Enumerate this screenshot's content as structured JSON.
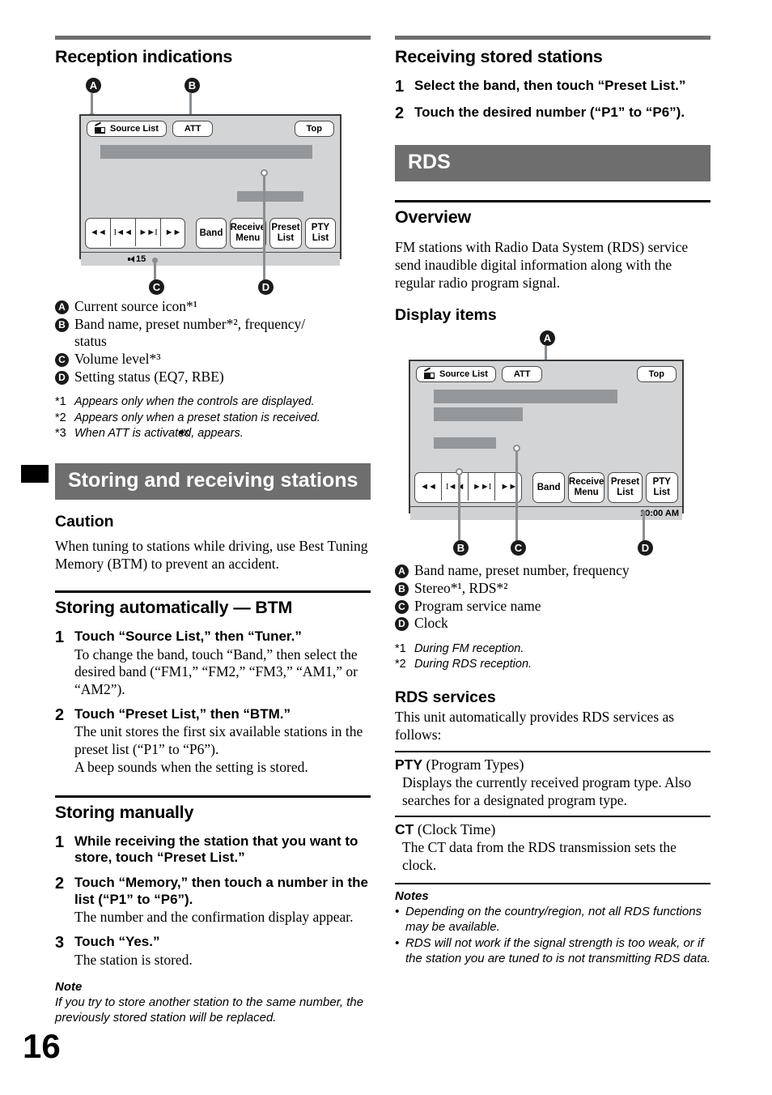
{
  "page_number": "16",
  "left_column": {
    "reception": {
      "heading": "Reception indications",
      "device": {
        "source_list_label": "Source List",
        "att_label": "ATT",
        "top_label": "Top",
        "transport": [
          "◄◄",
          "I◄◄",
          "►►I",
          "►►"
        ],
        "band_label": "Band",
        "receive_menu_label": "Receive\nMenu",
        "preset_list_label": "Preset\nList",
        "pty_list_label": "PTY\nList",
        "volume_value": "15",
        "callouts": [
          "A",
          "B",
          "C",
          "D"
        ]
      },
      "legend": [
        {
          "key": "A",
          "text": "Current source icon*¹"
        },
        {
          "key": "B",
          "text": "Band name, preset number*², frequency/"
        },
        {
          "key": "B2",
          "text": "status"
        },
        {
          "key": "C",
          "text": "Volume level*³"
        },
        {
          "key": "D",
          "text": "Setting status (EQ7, RBE)"
        }
      ],
      "footnotes": [
        {
          "mark": "*1",
          "text": "Appears only when the controls are displayed."
        },
        {
          "mark": "*2",
          "text": "Appears only when a preset station is received."
        },
        {
          "mark": "*3",
          "text": "When ATT is activated,      appears."
        }
      ]
    },
    "storing_banner": "Storing and receiving stations",
    "caution": {
      "heading": "Caution",
      "text": "When tuning to stations while driving, use Best Tuning Memory (BTM) to prevent an accident."
    },
    "btm": {
      "heading": "Storing automatically — BTM",
      "steps": [
        {
          "num": "1",
          "lead": "Touch “Source List,” then “Tuner.”",
          "desc": "To change the band, touch “Band,” then select the desired band (“FM1,” “FM2,” “FM3,” “AM1,” or “AM2”)."
        },
        {
          "num": "2",
          "lead": "Touch “Preset List,” then “BTM.”",
          "desc": "The unit stores the first six available stations in the preset list (“P1” to “P6”).\nA beep sounds when the setting is stored."
        }
      ]
    },
    "manual": {
      "heading": "Storing manually",
      "steps": [
        {
          "num": "1",
          "lead": "While receiving the station that you want to store, touch “Preset List.”",
          "desc": ""
        },
        {
          "num": "2",
          "lead": "Touch “Memory,” then touch a number in the list (“P1” to “P6”).",
          "desc": "The number and the confirmation display appear."
        },
        {
          "num": "3",
          "lead": "Touch “Yes.”",
          "desc": "The station is stored."
        }
      ]
    },
    "note": {
      "title": "Note",
      "text": "If you try to store another station to the same number, the previously stored station will be replaced."
    }
  },
  "right_column": {
    "receiving": {
      "heading": "Receiving stored stations",
      "steps": [
        {
          "num": "1",
          "lead": "Select the band, then touch “Preset List.”"
        },
        {
          "num": "2",
          "lead": "Touch the desired number (“P1” to “P6”)."
        }
      ]
    },
    "rds_banner": "RDS",
    "overview": {
      "heading": "Overview",
      "text": "FM stations with Radio Data System (RDS) service send inaudible digital information along with the regular radio program signal."
    },
    "display_items": {
      "heading": "Display items",
      "device": {
        "source_list_label": "Source List",
        "att_label": "ATT",
        "top_label": "Top",
        "transport": [
          "◄◄",
          "I◄◄",
          "►►I",
          "►►"
        ],
        "band_label": "Band",
        "receive_menu_label": "Receive\nMenu",
        "preset_list_label": "Preset\nList",
        "pty_list_label": "PTY\nList",
        "clock_value": "10:00 AM",
        "callouts": [
          "A",
          "B",
          "C",
          "D"
        ]
      },
      "legend": [
        {
          "key": "A",
          "text": "Band name, preset number, frequency"
        },
        {
          "key": "B",
          "text": "Stereo*¹, RDS*²"
        },
        {
          "key": "C",
          "text": "Program service name"
        },
        {
          "key": "D",
          "text": "Clock"
        }
      ],
      "footnotes": [
        {
          "mark": "*1",
          "text": "During FM reception."
        },
        {
          "mark": "*2",
          "text": "During RDS reception."
        }
      ]
    },
    "rds_services": {
      "heading": "RDS services",
      "intro": "This unit automatically provides RDS services as follows:",
      "items": [
        {
          "abbr": "PTY",
          "full": "(Program Types)",
          "lines": "Displays the currently received program type. Also searches for a designated program type."
        },
        {
          "abbr": "CT",
          "full": "(Clock Time)",
          "lines": "The CT data from the RDS transmission sets the clock."
        }
      ]
    },
    "notes": {
      "title": "Notes",
      "items": [
        "Depending on the country/region, not all RDS functions may be available.",
        "RDS will not work if the signal strength is too weak, or if the station you are tuned to is not transmitting RDS data."
      ]
    }
  }
}
